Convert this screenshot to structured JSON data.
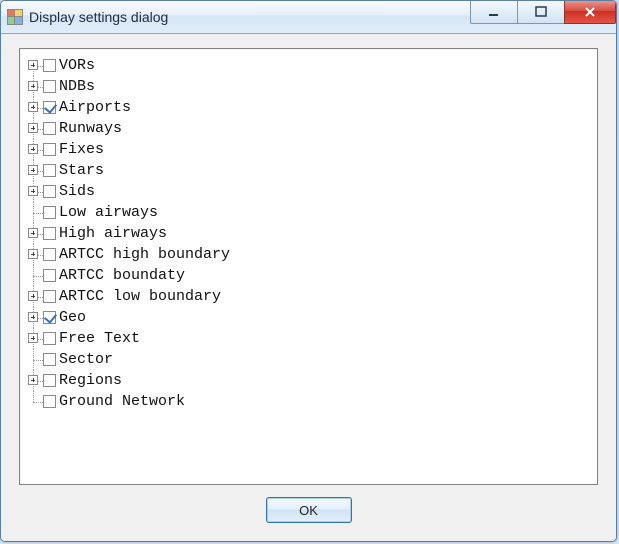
{
  "window": {
    "title": "Display settings dialog"
  },
  "buttons": {
    "ok_label": "OK"
  },
  "tree": {
    "items": [
      {
        "label": "VORs",
        "expandable": true,
        "checked": false
      },
      {
        "label": "NDBs",
        "expandable": true,
        "checked": false
      },
      {
        "label": "Airports",
        "expandable": true,
        "checked": true
      },
      {
        "label": "Runways",
        "expandable": true,
        "checked": false
      },
      {
        "label": "Fixes",
        "expandable": true,
        "checked": false
      },
      {
        "label": "Stars",
        "expandable": true,
        "checked": false
      },
      {
        "label": "Sids",
        "expandable": true,
        "checked": false
      },
      {
        "label": "Low airways",
        "expandable": false,
        "checked": false
      },
      {
        "label": "High airways",
        "expandable": true,
        "checked": false
      },
      {
        "label": "ARTCC high boundary",
        "expandable": true,
        "checked": false
      },
      {
        "label": "ARTCC boundaty",
        "expandable": false,
        "checked": false
      },
      {
        "label": "ARTCC low boundary",
        "expandable": true,
        "checked": false
      },
      {
        "label": "Geo",
        "expandable": true,
        "checked": true
      },
      {
        "label": "Free Text",
        "expandable": true,
        "checked": false
      },
      {
        "label": "Sector",
        "expandable": false,
        "checked": false
      },
      {
        "label": "Regions",
        "expandable": true,
        "checked": false
      },
      {
        "label": "Ground Network",
        "expandable": false,
        "checked": false
      }
    ]
  }
}
